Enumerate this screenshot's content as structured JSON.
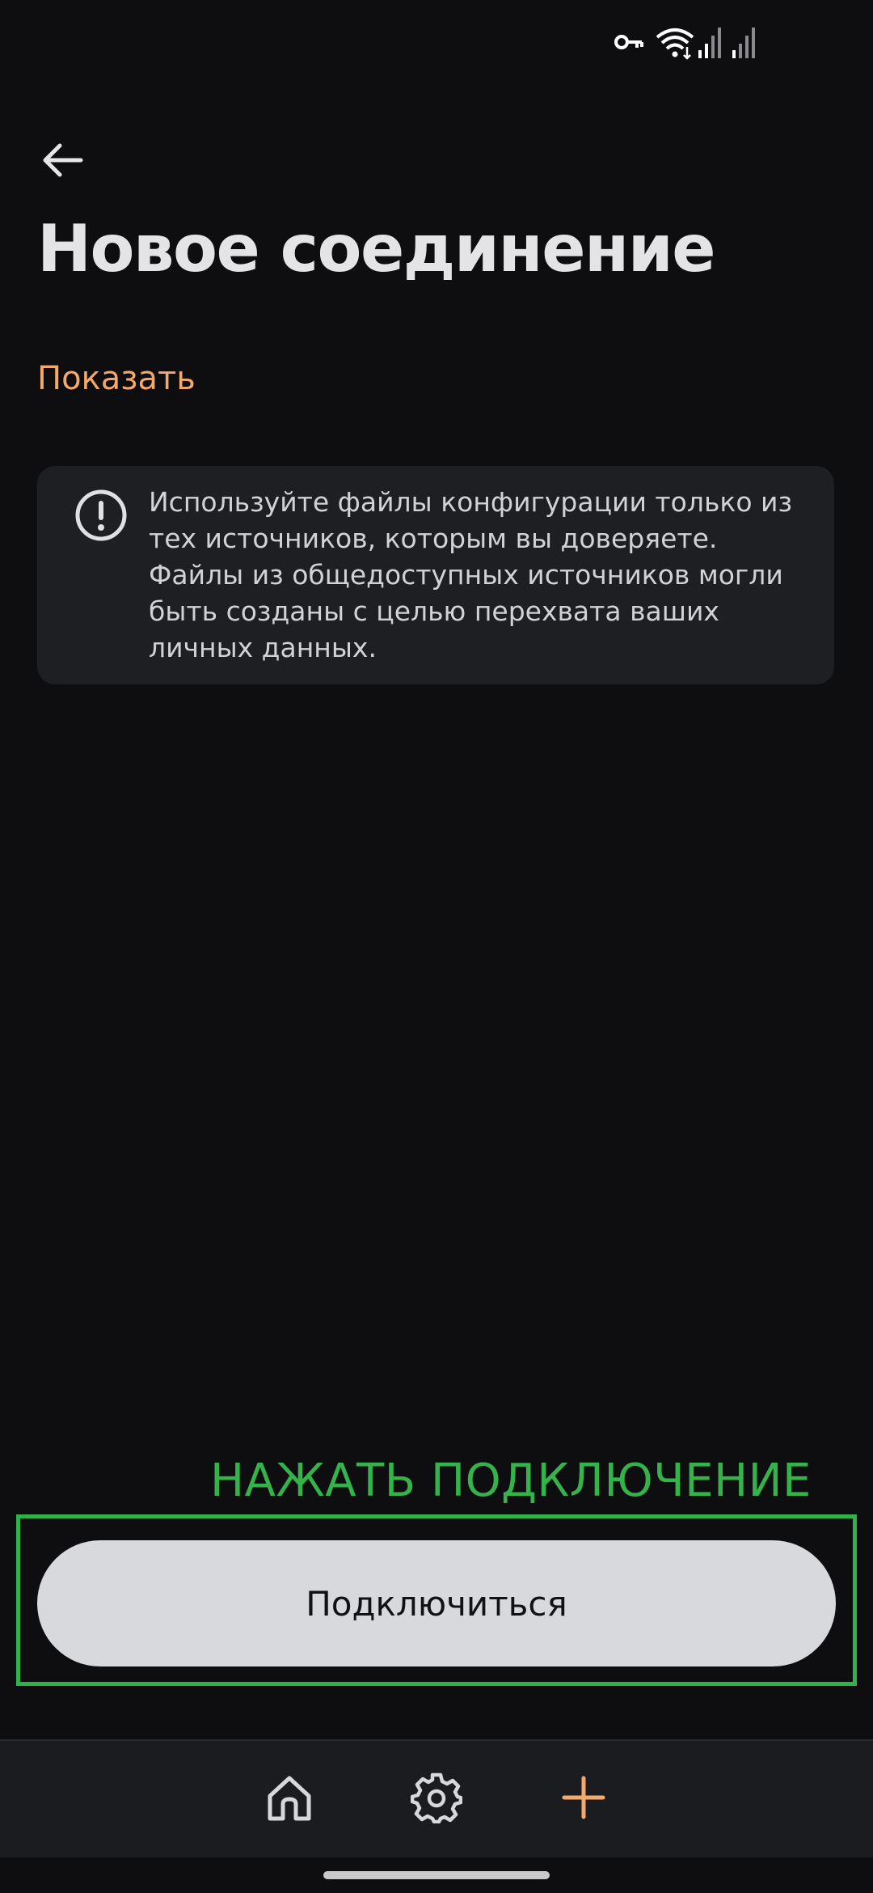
{
  "status_bar": {
    "icons": [
      "vpn-key-icon",
      "wifi-icon",
      "signal-icon",
      "signal-icon"
    ]
  },
  "header": {
    "back_icon": "arrow-left-icon",
    "title": "Новое соединение"
  },
  "show_link": "Показать",
  "warning": {
    "icon": "exclamation-circle-icon",
    "text": "Используйте файлы конфигурации только из тех источников, которым вы доверяете. Файлы из общедоступных источников могли быть созданы с целью перехвата ваших личных данных."
  },
  "annotation": {
    "hint": "НАЖАТЬ ПОДКЛЮЧЕНИЕ",
    "color": "#2fb24a"
  },
  "connect_button": {
    "label": "Подключиться"
  },
  "bottom_nav": {
    "items": [
      {
        "icon": "home-icon"
      },
      {
        "icon": "gear-icon"
      },
      {
        "icon": "plus-icon",
        "color": "#f2a96a"
      }
    ]
  },
  "colors": {
    "background": "#0e0e10",
    "accent": "#f2a96a",
    "card": "#1e1f22",
    "button": "#d8d9dd"
  }
}
